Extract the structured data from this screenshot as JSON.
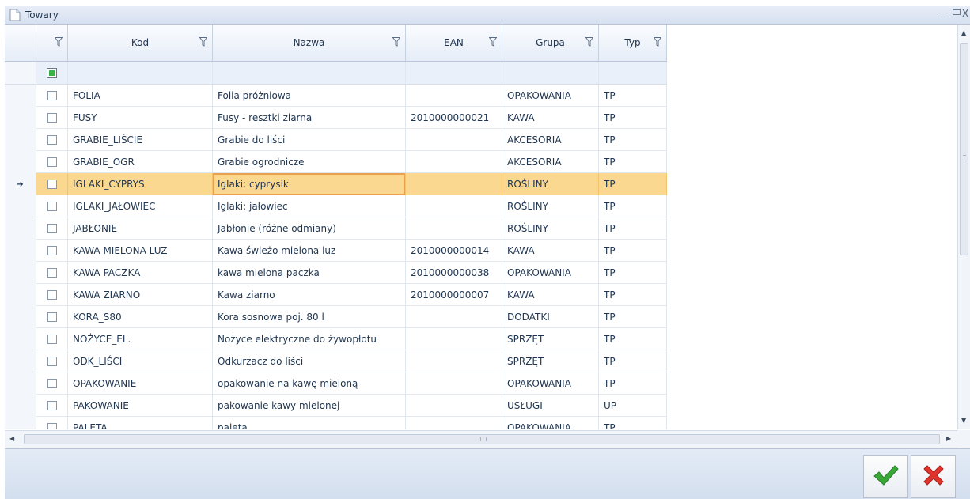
{
  "window": {
    "title": "Towary"
  },
  "columns": {
    "kod": "Kod",
    "nazwa": "Nazwa",
    "ean": "EAN",
    "grupa": "Grupa",
    "typ": "Typ"
  },
  "rows": [
    {
      "kod": "FOLIA",
      "nazwa": "Folia próżniowa",
      "ean": "",
      "grupa": "OPAKOWANIA",
      "typ": "TP"
    },
    {
      "kod": "FUSY",
      "nazwa": "Fusy - resztki ziarna",
      "ean": "2010000000021",
      "grupa": "KAWA",
      "typ": "TP"
    },
    {
      "kod": "GRABIE_LIŚCIE",
      "nazwa": "Grabie do liści",
      "ean": "",
      "grupa": "AKCESORIA",
      "typ": "TP"
    },
    {
      "kod": "GRABIE_OGR",
      "nazwa": "Grabie ogrodnicze",
      "ean": "",
      "grupa": "AKCESORIA",
      "typ": "TP"
    },
    {
      "kod": "IGLAKI_CYPRYS",
      "nazwa": "Iglaki: cyprysik",
      "ean": "",
      "grupa": "ROŚLINY",
      "typ": "TP"
    },
    {
      "kod": "IGLAKI_JAŁOWIEC",
      "nazwa": "Iglaki: jałowiec",
      "ean": "",
      "grupa": "ROŚLINY",
      "typ": "TP"
    },
    {
      "kod": "JABŁONIE",
      "nazwa": "Jabłonie (różne odmiany)",
      "ean": "",
      "grupa": "ROŚLINY",
      "typ": "TP"
    },
    {
      "kod": "KAWA MIELONA LUZ",
      "nazwa": "Kawa świeżo mielona luz",
      "ean": "2010000000014",
      "grupa": "KAWA",
      "typ": "TP"
    },
    {
      "kod": "KAWA PACZKA",
      "nazwa": "kawa mielona paczka",
      "ean": "2010000000038",
      "grupa": "OPAKOWANIA",
      "typ": "TP"
    },
    {
      "kod": "KAWA ZIARNO",
      "nazwa": "Kawa ziarno",
      "ean": "2010000000007",
      "grupa": "KAWA",
      "typ": "TP"
    },
    {
      "kod": "KORA_S80",
      "nazwa": "Kora sosnowa poj. 80 l",
      "ean": "",
      "grupa": "DODATKI",
      "typ": "TP"
    },
    {
      "kod": "NOŻYCE_EL.",
      "nazwa": "Nożyce elektryczne do żywopłotu",
      "ean": "",
      "grupa": "SPRZĘT",
      "typ": "TP"
    },
    {
      "kod": "ODK_LIŚCI",
      "nazwa": "Odkurzacz do liści",
      "ean": "",
      "grupa": "SPRZĘT",
      "typ": "TP"
    },
    {
      "kod": "OPAKOWANIE",
      "nazwa": "opakowanie na kawę mieloną",
      "ean": "",
      "grupa": "OPAKOWANIA",
      "typ": "TP"
    },
    {
      "kod": "PAKOWANIE",
      "nazwa": "pakowanie kawy mielonej",
      "ean": "",
      "grupa": "USŁUGI",
      "typ": "UP"
    },
    {
      "kod": "PALETA",
      "nazwa": "paleta",
      "ean": "",
      "grupa": "OPAKOWANIA",
      "typ": "TP"
    }
  ],
  "selected_row_index": 4,
  "colors": {
    "selected_row": "#fbd88f",
    "ok_check": "#3aa839",
    "cancel_x": "#e0332c"
  },
  "icons": {
    "window": "document-icon",
    "filter": "filter-funnel-icon",
    "ok": "checkmark-icon",
    "cancel": "x-icon"
  }
}
